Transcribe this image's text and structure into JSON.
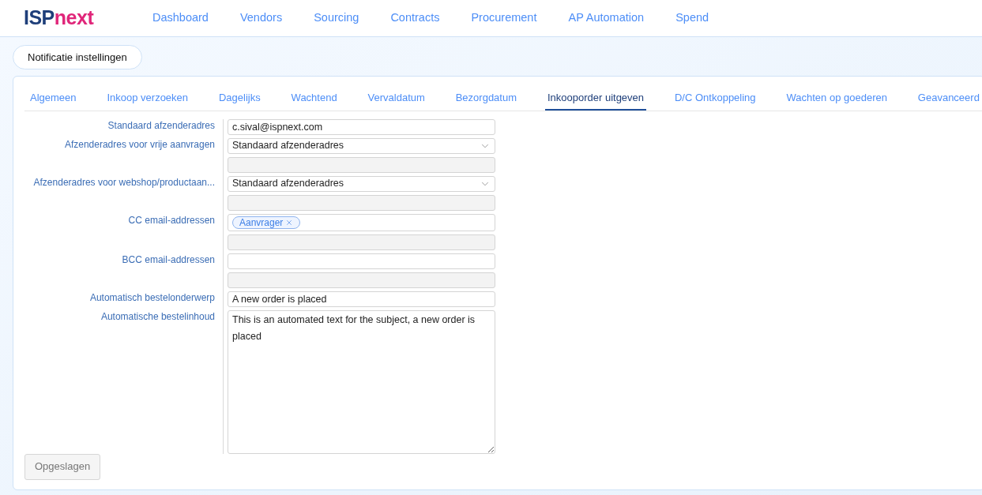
{
  "logo": {
    "part_1": "ISP",
    "part_2": "next"
  },
  "nav": [
    {
      "label": "Dashboard"
    },
    {
      "label": "Vendors"
    },
    {
      "label": "Sourcing"
    },
    {
      "label": "Contracts"
    },
    {
      "label": "Procurement"
    },
    {
      "label": "AP Automation"
    },
    {
      "label": "Spend"
    }
  ],
  "section_button": "Notificatie instellingen",
  "tabs": [
    {
      "label": "Algemeen",
      "selected": false
    },
    {
      "label": "Inkoop verzoeken",
      "selected": false
    },
    {
      "label": "Dagelijks",
      "selected": false
    },
    {
      "label": "Wachtend",
      "selected": false
    },
    {
      "label": "Vervaldatum",
      "selected": false
    },
    {
      "label": "Bezorgdatum",
      "selected": false
    },
    {
      "label": "Inkooporder uitgeven",
      "selected": true
    },
    {
      "label": "D/C Ontkoppeling",
      "selected": false
    },
    {
      "label": "Wachten op goederen",
      "selected": false
    },
    {
      "label": "Geavanceerd",
      "selected": false
    }
  ],
  "fields": [
    {
      "kind": "text",
      "label": "Standaard afzenderadres",
      "value": "c.sival@ispnext.com"
    },
    {
      "kind": "select",
      "label": "Afzenderadres voor vrije aanvragen",
      "value": "Standaard afzenderadres"
    },
    {
      "kind": "disabled"
    },
    {
      "kind": "select",
      "label": "Afzenderadres voor webshop/productaan...",
      "value": "Standaard afzenderadres"
    },
    {
      "kind": "disabled"
    },
    {
      "kind": "tags",
      "label": "CC email-addressen",
      "tags": [
        "Aanvrager"
      ]
    },
    {
      "kind": "disabled"
    },
    {
      "kind": "text",
      "label": "BCC email-addressen"
    },
    {
      "kind": "disabled"
    },
    {
      "kind": "text",
      "label": "Automatisch bestelonderwerp",
      "value": "A new order is placed"
    },
    {
      "kind": "textarea",
      "label": "Automatische bestelinhoud",
      "value": "This is an automated text for the subject, a new order is placed"
    }
  ],
  "save_button": {
    "label": "Opgeslagen",
    "disabled": true
  }
}
